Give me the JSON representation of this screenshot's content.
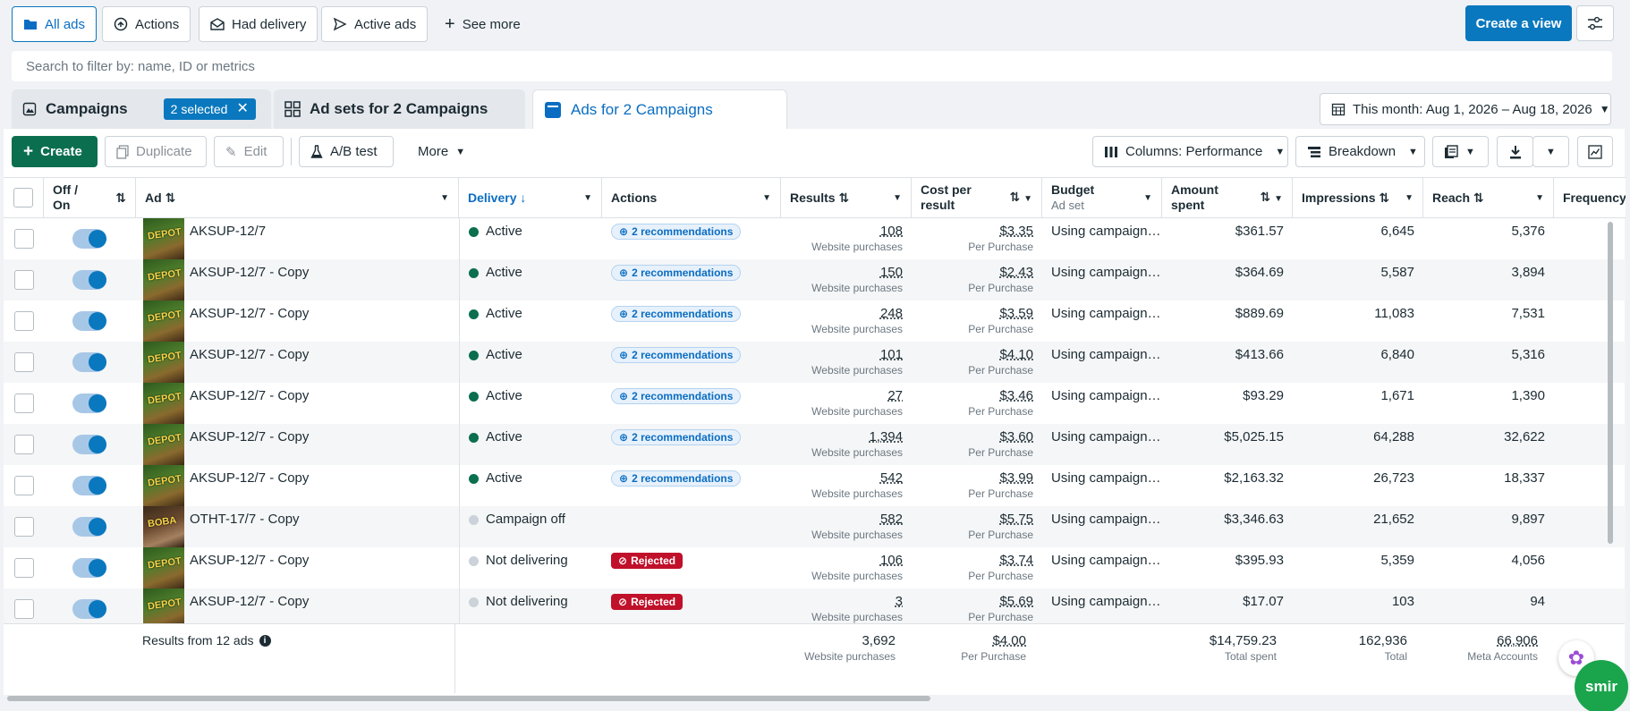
{
  "view_tabs": [
    {
      "label": "All ads",
      "icon": "folder-icon",
      "active": true
    },
    {
      "label": "Actions",
      "icon": "arrow-circle-icon",
      "active": false
    },
    {
      "label": "Had delivery",
      "icon": "envelope-open-icon",
      "active": false
    },
    {
      "label": "Active ads",
      "icon": "send-icon",
      "active": false
    },
    {
      "label": "See more",
      "icon": "plus-icon",
      "active": false
    }
  ],
  "create_view_label": "Create a view",
  "search_placeholder": "Search to filter by: name, ID or metrics",
  "level_tabs": {
    "campaigns": "Campaigns",
    "selected_badge": "2 selected",
    "adsets": "Ad sets for 2 Campaigns",
    "ads": "Ads for 2 Campaigns"
  },
  "date_range": "This month: Aug 1, 2026 – Aug 18, 2026",
  "toolbar": {
    "create": "Create",
    "duplicate": "Duplicate",
    "edit": "Edit",
    "ab_test": "A/B test",
    "more": "More",
    "columns": "Columns: Performance",
    "breakdown": "Breakdown"
  },
  "columns": {
    "off_on": "Off / On",
    "ad": "Ad",
    "delivery": "Delivery",
    "actions": "Actions",
    "results": "Results",
    "cost_per_result": "Cost per result",
    "budget": "Budget",
    "budget_sub": "Ad set",
    "amount_spent": "Amount spent",
    "impressions": "Impressions",
    "reach": "Reach",
    "frequency": "Frequency"
  },
  "rows": [
    {
      "name": "AKSUP-12/7",
      "thumb": "DEPOT",
      "delivery": "Active",
      "status": "active",
      "action": "2 recommendations",
      "action_type": "rec",
      "results": "108",
      "results_sub": "Website purchases",
      "cpr": "$3.35",
      "cpr_sub": "Per Purchase",
      "budget": "Using campaign…",
      "spent": "$361.57",
      "impressions": "6,645",
      "reach": "5,376"
    },
    {
      "name": "AKSUP-12/7 - Copy",
      "thumb": "DEPOT",
      "delivery": "Active",
      "status": "active",
      "action": "2 recommendations",
      "action_type": "rec",
      "results": "150",
      "results_sub": "Website purchases",
      "cpr": "$2.43",
      "cpr_sub": "Per Purchase",
      "budget": "Using campaign…",
      "spent": "$364.69",
      "impressions": "5,587",
      "reach": "3,894"
    },
    {
      "name": "AKSUP-12/7 - Copy",
      "thumb": "DEPOT",
      "delivery": "Active",
      "status": "active",
      "action": "2 recommendations",
      "action_type": "rec",
      "results": "248",
      "results_sub": "Website purchases",
      "cpr": "$3.59",
      "cpr_sub": "Per Purchase",
      "budget": "Using campaign…",
      "spent": "$889.69",
      "impressions": "11,083",
      "reach": "7,531"
    },
    {
      "name": "AKSUP-12/7 - Copy",
      "thumb": "DEPOT",
      "delivery": "Active",
      "status": "active",
      "action": "2 recommendations",
      "action_type": "rec",
      "results": "101",
      "results_sub": "Website purchases",
      "cpr": "$4.10",
      "cpr_sub": "Per Purchase",
      "budget": "Using campaign…",
      "spent": "$413.66",
      "impressions": "6,840",
      "reach": "5,316"
    },
    {
      "name": "AKSUP-12/7 - Copy",
      "thumb": "DEPOT",
      "delivery": "Active",
      "status": "active",
      "action": "2 recommendations",
      "action_type": "rec",
      "results": "27",
      "results_sub": "Website purchases",
      "cpr": "$3.46",
      "cpr_sub": "Per Purchase",
      "budget": "Using campaign…",
      "spent": "$93.29",
      "impressions": "1,671",
      "reach": "1,390"
    },
    {
      "name": "AKSUP-12/7 - Copy",
      "thumb": "DEPOT",
      "delivery": "Active",
      "status": "active",
      "action": "2 recommendations",
      "action_type": "rec",
      "results": "1,394",
      "results_sub": "Website purchases",
      "cpr": "$3.60",
      "cpr_sub": "Per Purchase",
      "budget": "Using campaign…",
      "spent": "$5,025.15",
      "impressions": "64,288",
      "reach": "32,622"
    },
    {
      "name": "AKSUP-12/7 - Copy",
      "thumb": "DEPOT",
      "delivery": "Active",
      "status": "active",
      "action": "2 recommendations",
      "action_type": "rec",
      "results": "542",
      "results_sub": "Website purchases",
      "cpr": "$3.99",
      "cpr_sub": "Per Purchase",
      "budget": "Using campaign…",
      "spent": "$2,163.32",
      "impressions": "26,723",
      "reach": "18,337"
    },
    {
      "name": "OTHT-17/7 - Copy",
      "thumb": "BOBA",
      "delivery": "Campaign off",
      "status": "off",
      "action": "",
      "action_type": "none",
      "results": "582",
      "results_sub": "Website purchases",
      "cpr": "$5.75",
      "cpr_sub": "Per Purchase",
      "budget": "Using campaign…",
      "spent": "$3,346.63",
      "impressions": "21,652",
      "reach": "9,897"
    },
    {
      "name": "AKSUP-12/7 - Copy",
      "thumb": "DEPOT",
      "delivery": "Not delivering",
      "status": "off",
      "action": "Rejected",
      "action_type": "rej",
      "results": "106",
      "results_sub": "Website purchases",
      "cpr": "$3.74",
      "cpr_sub": "Per Purchase",
      "budget": "Using campaign…",
      "spent": "$395.93",
      "impressions": "5,359",
      "reach": "4,056"
    },
    {
      "name": "AKSUP-12/7 - Copy",
      "thumb": "DEPOT",
      "delivery": "Not delivering",
      "status": "off",
      "action": "Rejected",
      "action_type": "rej",
      "results": "3",
      "results_sub": "Website purchases",
      "cpr": "$5.69",
      "cpr_sub": "Per Purchase",
      "budget": "Using campaign…",
      "spent": "$17.07",
      "impressions": "103",
      "reach": "94"
    }
  ],
  "totals": {
    "label": "Results from 12 ads",
    "results": "3,692",
    "results_sub": "Website purchases",
    "cpr": "$4.00",
    "cpr_sub": "Per Purchase",
    "spent": "$14,759.23",
    "spent_sub": "Total spent",
    "impressions": "162,936",
    "impressions_sub": "Total",
    "reach": "66,906",
    "reach_sub": "Meta Accounts"
  },
  "widget_label": "smir",
  "colors": {
    "accent": "#0a78be",
    "create_green": "#0b6e4f",
    "active_dot": "#0b6e4f",
    "rejected": "#c0102a"
  }
}
